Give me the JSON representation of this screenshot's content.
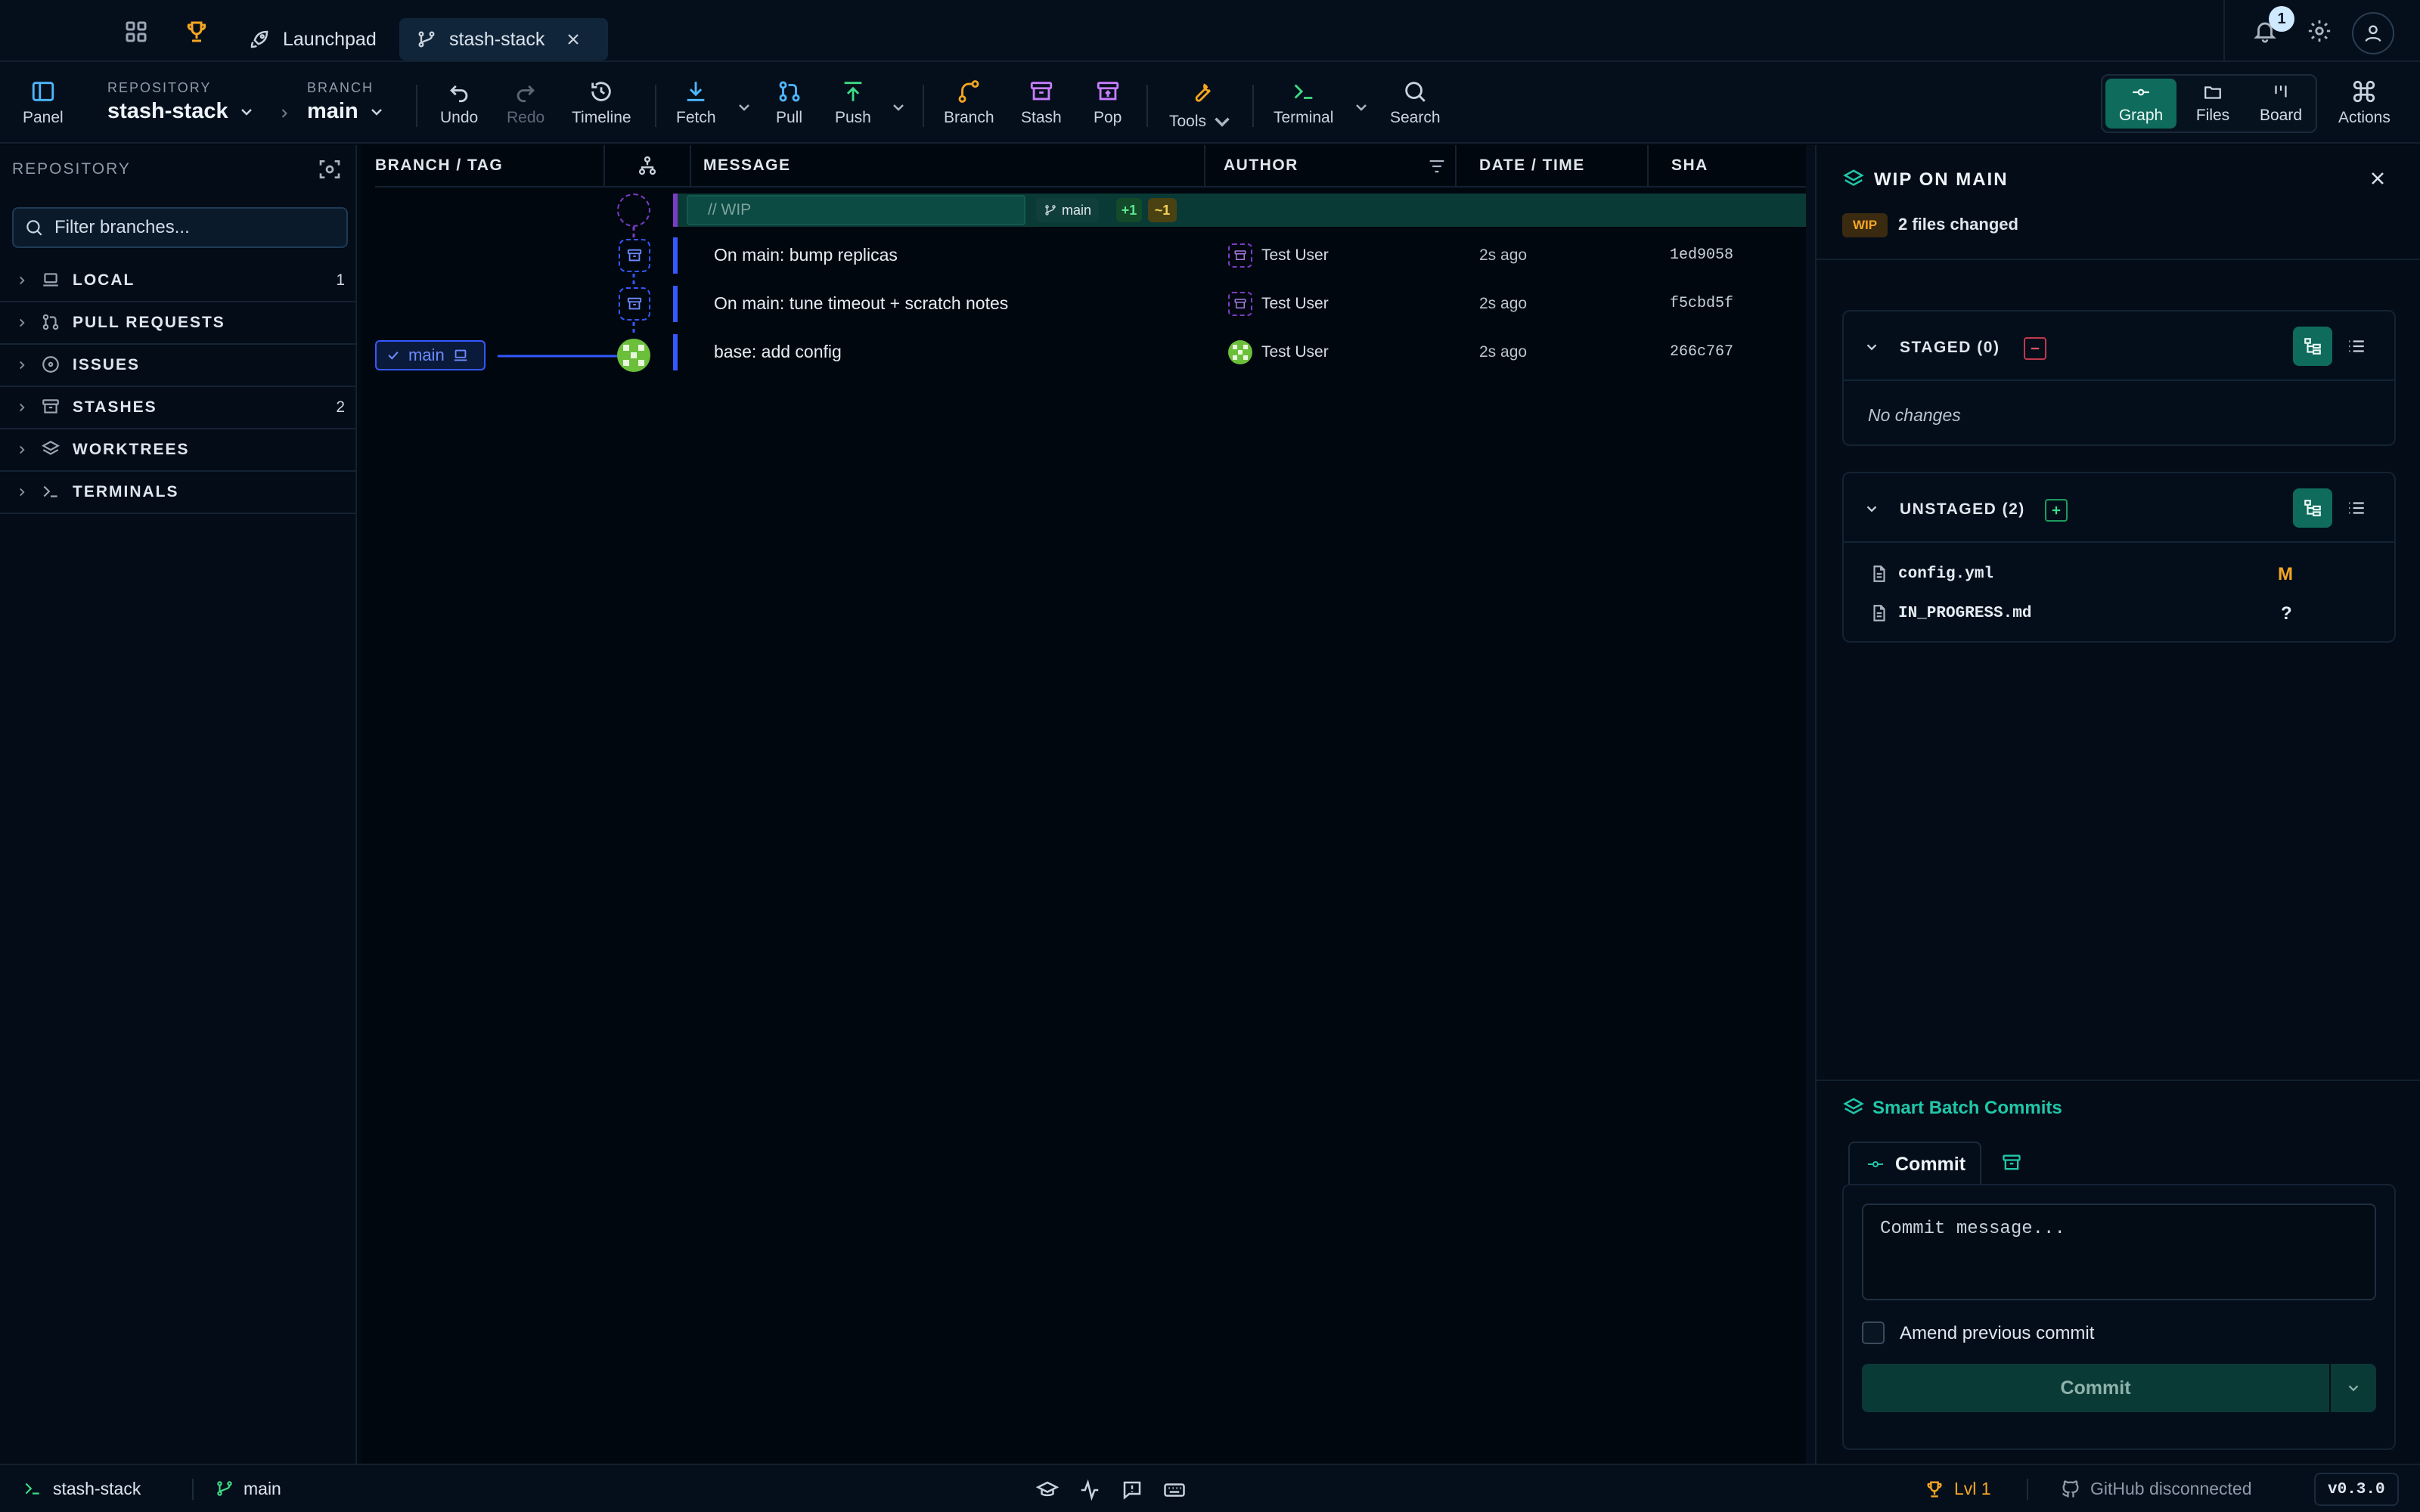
{
  "titlebar": {
    "tabs": [
      {
        "label": "Launchpad",
        "icon": "rocket-icon"
      },
      {
        "label": "stash-stack",
        "icon": "branch-icon",
        "active": true
      }
    ],
    "notification_count": "1"
  },
  "toolbar": {
    "panel_label": "Panel",
    "repository_caption": "REPOSITORY",
    "repository_name": "stash-stack",
    "branch_caption": "BRANCH",
    "branch_name": "main",
    "undo": "Undo",
    "redo": "Redo",
    "timeline": "Timeline",
    "fetch": "Fetch",
    "pull": "Pull",
    "push": "Push",
    "branch": "Branch",
    "stash": "Stash",
    "pop": "Pop",
    "tools": "Tools",
    "terminal": "Terminal",
    "search": "Search",
    "views": {
      "graph": "Graph",
      "files": "Files",
      "board": "Board"
    },
    "actions": "Actions"
  },
  "sidebar": {
    "title": "REPOSITORY",
    "filter_placeholder": "Filter branches...",
    "sections": [
      {
        "label": "LOCAL",
        "count": "1",
        "icon": "laptop-icon"
      },
      {
        "label": "PULL REQUESTS",
        "count": "",
        "icon": "pull-request-icon"
      },
      {
        "label": "ISSUES",
        "count": "",
        "icon": "issue-icon"
      },
      {
        "label": "STASHES",
        "count": "2",
        "icon": "archive-icon"
      },
      {
        "label": "WORKTREES",
        "count": "",
        "icon": "layers-icon"
      },
      {
        "label": "TERMINALS",
        "count": "",
        "icon": "terminal-icon"
      }
    ]
  },
  "graph": {
    "columns": {
      "branch_tag": "BRANCH / TAG",
      "message": "MESSAGE",
      "author": "AUTHOR",
      "date_time": "DATE / TIME",
      "sha": "SHA"
    },
    "wip": {
      "placeholder": "// WIP",
      "branch": "main",
      "added": "+1",
      "modified": "~1"
    },
    "commits": [
      {
        "message": "On main: bump replicas",
        "author": "Test User",
        "date": "2s ago",
        "sha": "1ed9058",
        "kind": "stash"
      },
      {
        "message": "On main: tune timeout + scratch notes",
        "author": "Test User",
        "date": "2s ago",
        "sha": "f5cbd5f",
        "kind": "stash"
      },
      {
        "message": "base: add config",
        "author": "Test User",
        "date": "2s ago",
        "sha": "266c767",
        "kind": "commit"
      }
    ],
    "branch_label": "main",
    "colors": {
      "accent": "#3358ff",
      "wip": "#7a3cc4",
      "teal": "#0f6b5c"
    }
  },
  "right_panel": {
    "title": "WIP ON MAIN",
    "wip_badge": "WIP",
    "files_changed": "2 files changed",
    "staged": {
      "label": "STAGED (0)",
      "empty": "No changes"
    },
    "unstaged": {
      "label": "UNSTAGED (2)",
      "files": [
        {
          "name": "config.yml",
          "status": "M"
        },
        {
          "name": "IN_PROGRESS.md",
          "status": "?"
        }
      ]
    },
    "smart_batch": "Smart Batch Commits",
    "commit_tab": "Commit",
    "commit_placeholder": "Commit message...",
    "amend_label": "Amend previous commit",
    "commit_button": "Commit"
  },
  "statusbar": {
    "repo": "stash-stack",
    "branch": "main",
    "level": "Lvl 1",
    "github": "GitHub disconnected",
    "version": "v0.3.0"
  }
}
